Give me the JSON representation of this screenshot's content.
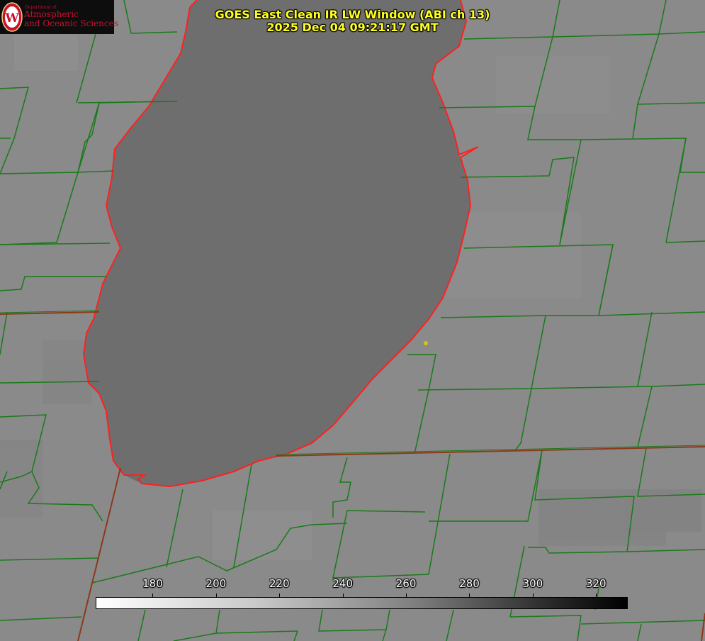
{
  "logo": {
    "dept": "Department of",
    "line1": "Atmospheric",
    "line2": "and Oceanic Sciences",
    "seal_letter": "W",
    "seal_color": "#c8102e"
  },
  "title": {
    "line1": "GOES East Clean IR LW Window (ABI ch 13)",
    "line2": "2025 Dec 04 09:21:17 GMT",
    "color": "#ffff22"
  },
  "colorbar": {
    "ticks": [
      "180",
      "200",
      "220",
      "240",
      "260",
      "280",
      "300",
      "320"
    ],
    "min": 162,
    "max": 330,
    "start_color": "#ffffff",
    "end_color": "#000000"
  },
  "map": {
    "land_color": "#8a8a8a",
    "lake_color": "#6e6e6e",
    "county_line_color": "#1a7a1a",
    "shoreline_color": "#ff2020",
    "state_line_color": "#8b3a1a",
    "marker_color": "#d4c21a"
  }
}
